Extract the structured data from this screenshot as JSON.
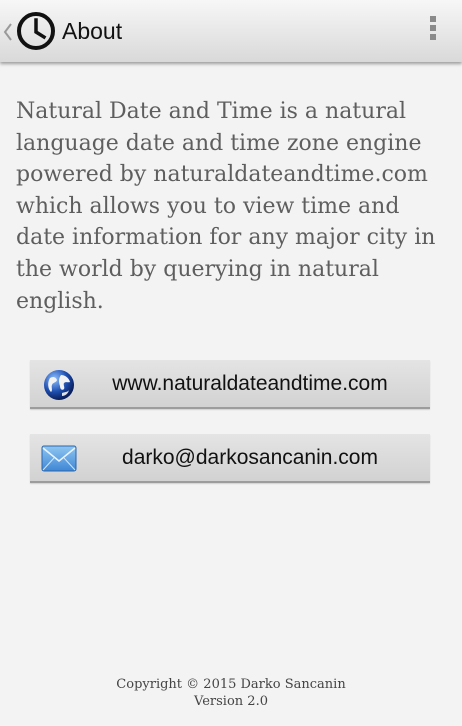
{
  "action_bar": {
    "title": "About",
    "up_icon": "chevron-left-icon",
    "app_icon": "clock-icon",
    "menu_icon": "overflow-menu-icon"
  },
  "about": {
    "description": "Natural Date and Time is a natural language date and time zone engine powered by naturaldateandtime.com which allows you to view time and date information for any major city in the world by querying in natural english."
  },
  "buttons": {
    "website": {
      "label": "www.naturaldateandtime.com",
      "icon": "globe-icon"
    },
    "email": {
      "label": "darko@darkosancanin.com",
      "icon": "envelope-icon"
    }
  },
  "footer": {
    "copyright": "Copyright © 2015 Darko Sancanin",
    "version": "Version 2.0"
  },
  "colors": {
    "background": "#f3f3f3",
    "action_bar": "#e6e6e6",
    "text": "#5e5e5e",
    "button": "#dcdcdc"
  }
}
